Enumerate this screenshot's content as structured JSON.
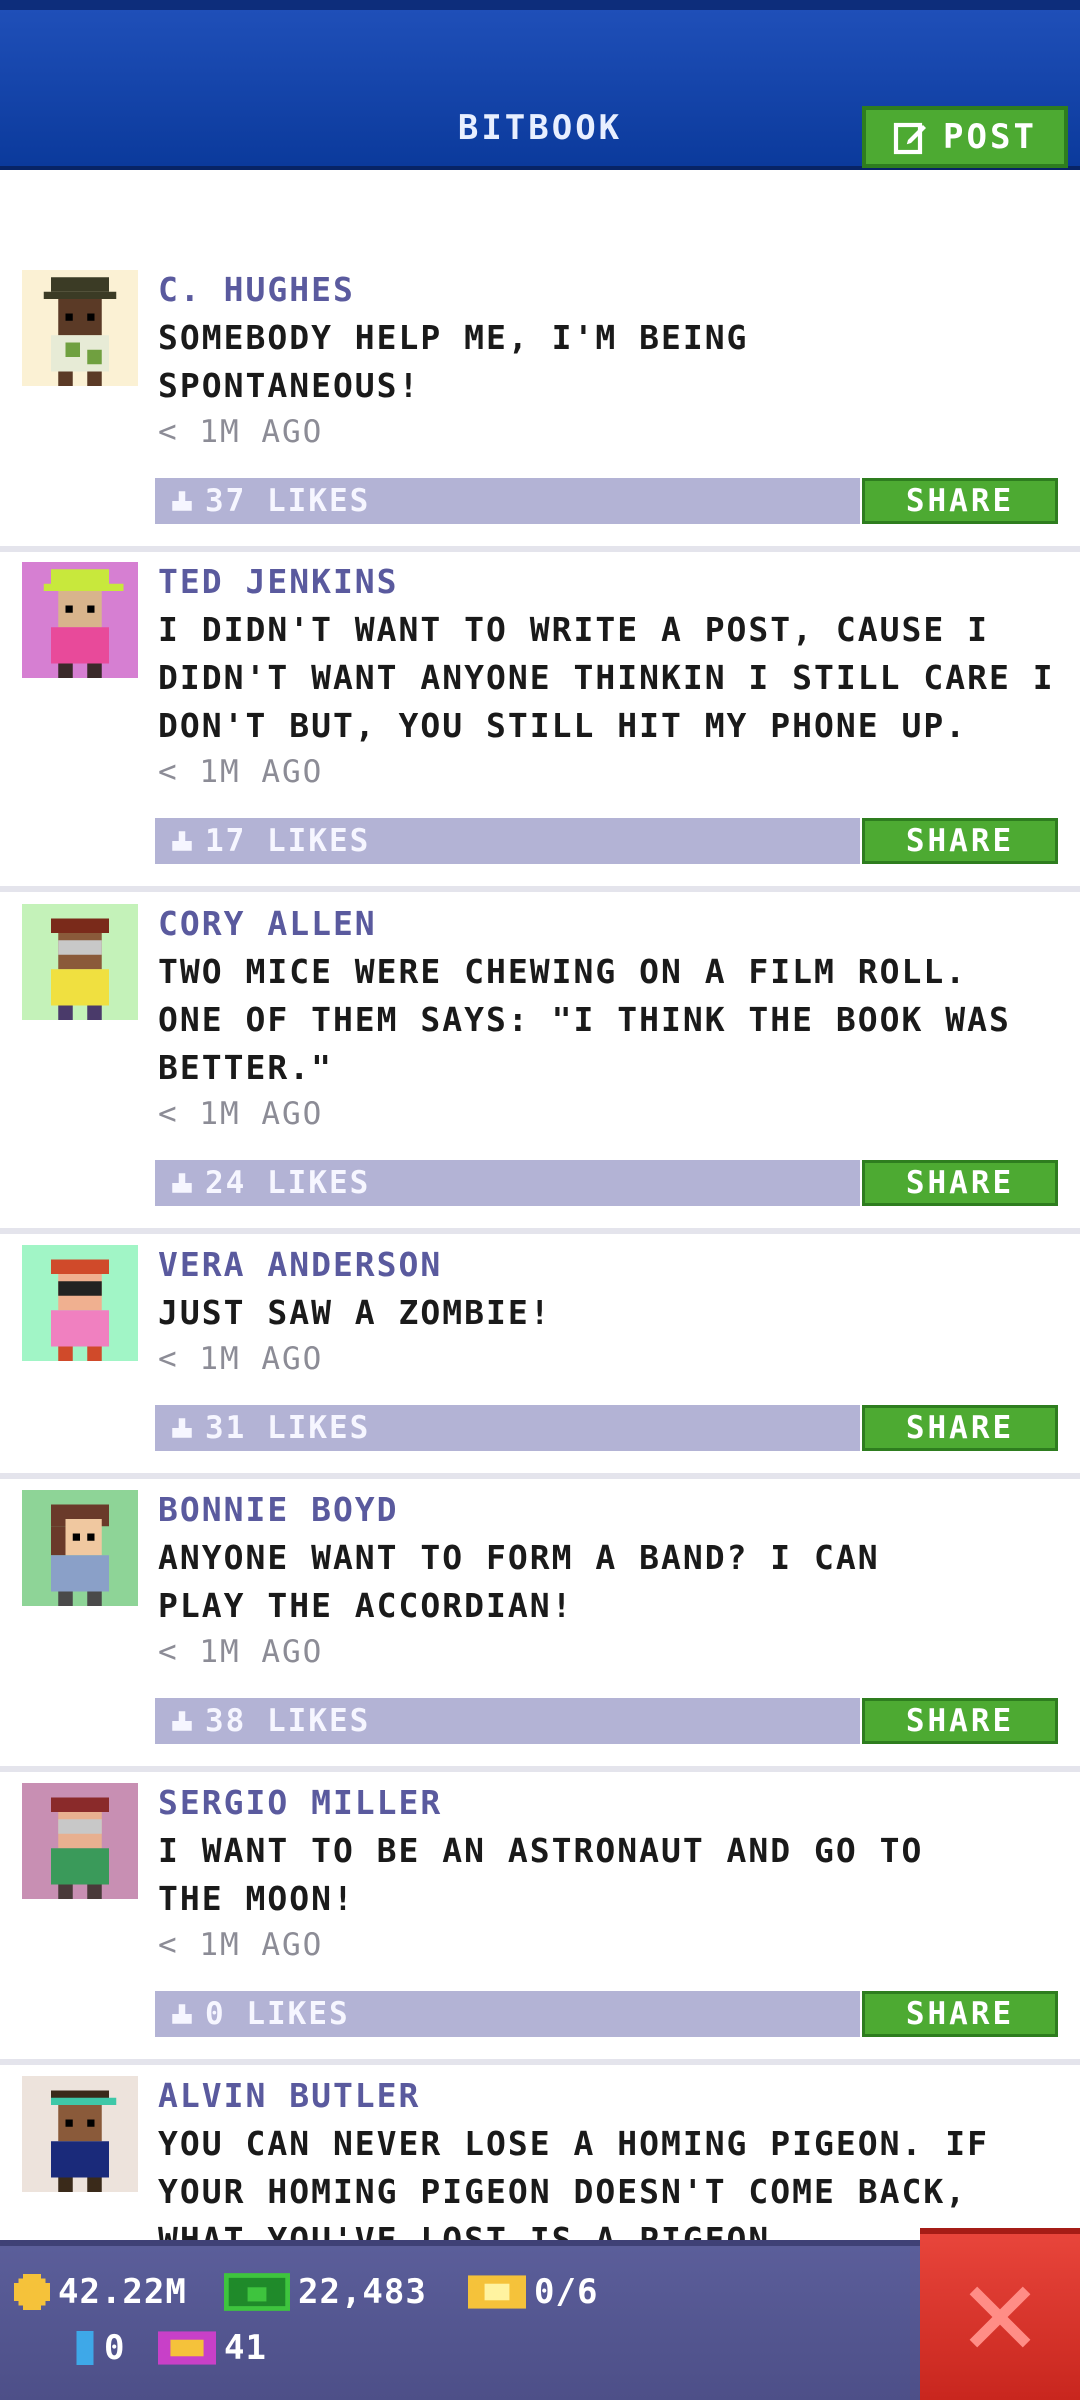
{
  "header": {
    "title": "BITBOOK",
    "post_label": "POST"
  },
  "posts": [
    {
      "author": "C. HUGHES",
      "message": "SOMEBODY HELP ME, I'M BEING\nSPONTANEOUS!",
      "timestamp": "< 1M AGO",
      "likes": "37 LIKES",
      "share_label": "SHARE",
      "avatar_bg": "#fbf1d4"
    },
    {
      "author": "TED JENKINS",
      "message": "I DIDN'T WANT TO WRITE A POST, CAUSE I\nDIDN'T WANT ANYONE THINKIN I STILL CARE I\nDON'T BUT, YOU STILL HIT MY PHONE UP.",
      "timestamp": "< 1M AGO",
      "likes": "17 LIKES",
      "share_label": "SHARE",
      "avatar_bg": "#d67fd2"
    },
    {
      "author": "CORY ALLEN",
      "message": "TWO MICE WERE CHEWING ON A FILM ROLL.\nONE OF THEM SAYS: \"I THINK THE BOOK WAS\nBETTER.\"",
      "timestamp": "< 1M AGO",
      "likes": "24 LIKES",
      "share_label": "SHARE",
      "avatar_bg": "#c4f2b9"
    },
    {
      "author": "VERA ANDERSON",
      "message": "JUST SAW A ZOMBIE!",
      "timestamp": "< 1M AGO",
      "likes": "31 LIKES",
      "share_label": "SHARE",
      "avatar_bg": "#a1f5c6"
    },
    {
      "author": "BONNIE BOYD",
      "message": "ANYONE WANT TO FORM A BAND? I CAN\nPLAY THE ACCORDIAN!",
      "timestamp": "< 1M AGO",
      "likes": "38 LIKES",
      "share_label": "SHARE",
      "avatar_bg": "#8ed497"
    },
    {
      "author": "SERGIO MILLER",
      "message": "I WANT TO BE AN ASTRONAUT AND GO TO\nTHE MOON!",
      "timestamp": "< 1M AGO",
      "likes": "0 LIKES",
      "share_label": "SHARE",
      "avatar_bg": "#c88fb3"
    },
    {
      "author": "ALVIN BUTLER",
      "message": "YOU CAN NEVER LOSE A HOMING PIGEON. IF\nYOUR HOMING PIGEON DOESN'T COME BACK,\nWHAT YOU'VE LOST IS A PIGEON.",
      "timestamp": "",
      "likes": "",
      "share_label": "",
      "avatar_bg": "#ede3dc"
    }
  ],
  "footer": {
    "coins": "42.22M",
    "bux": "22,483",
    "tickets": "0/6",
    "items": "0",
    "vip": "41"
  },
  "colors": {
    "header_blue": "#0b3a9c",
    "share_green": "#4daa32",
    "likes_bar": "#b3b3d5",
    "author_purple": "#5a5a9e",
    "close_red": "#d8322a"
  }
}
